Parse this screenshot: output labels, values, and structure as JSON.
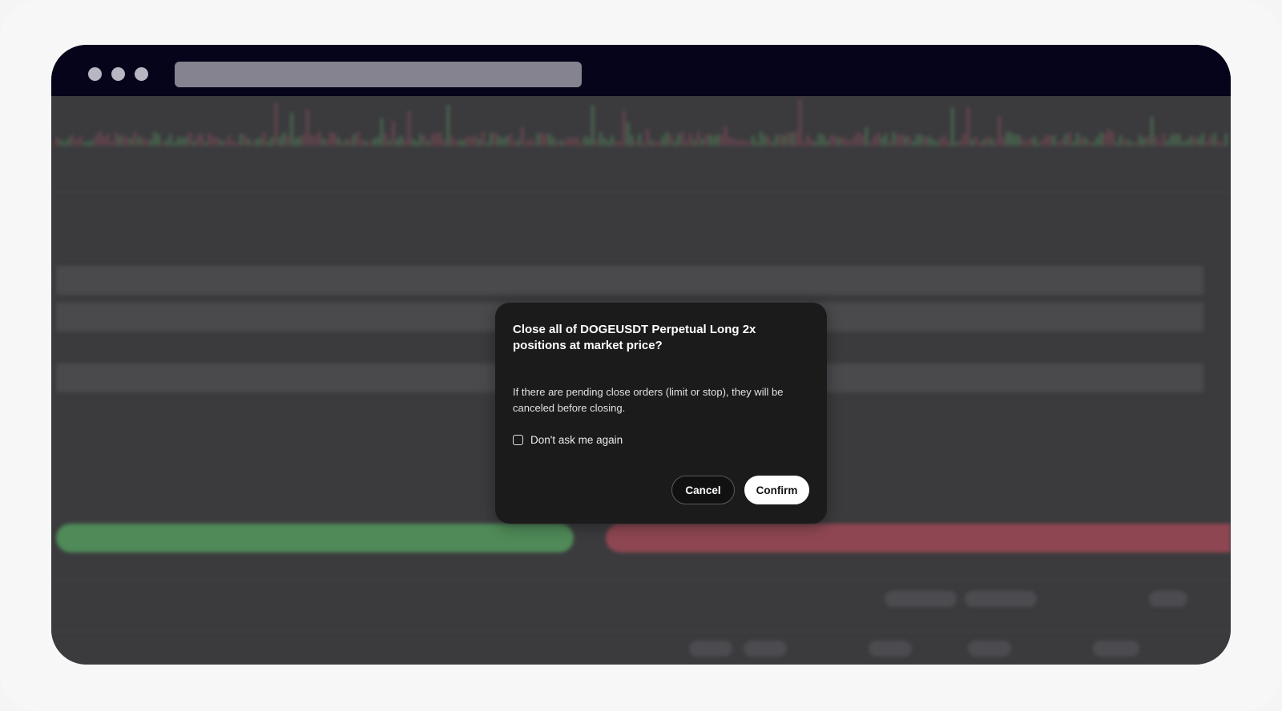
{
  "modal": {
    "title": "Close all of DOGEUSDT Perpetual Long 2x positions at market price?",
    "body": "If there are pending close orders (limit or stop), they will be canceled before closing.",
    "checkbox_label": "Don't ask me again",
    "checkbox_checked": false,
    "cancel_label": "Cancel",
    "confirm_label": "Confirm"
  },
  "colors": {
    "titlebar": "#06041a",
    "modal_bg": "#1b1b1c",
    "buy": "#4f8a58",
    "sell": "#8e4752",
    "confirm_bg": "#ffffff"
  }
}
